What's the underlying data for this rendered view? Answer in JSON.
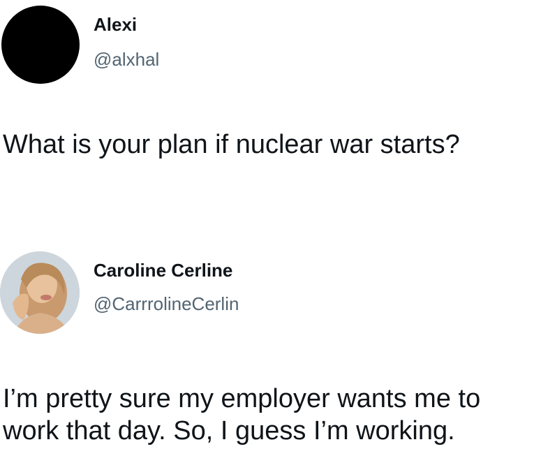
{
  "posts": [
    {
      "author": {
        "name": "Alexi",
        "handle": "@alxhal",
        "avatar_icon": "black-circle-avatar"
      },
      "text_lines": [
        "What is your plan if nuclear war starts?"
      ]
    },
    {
      "author": {
        "name": "Caroline Cerline",
        "handle": "@CarrrolineCerlin",
        "avatar_icon": "profile-photo-avatar"
      },
      "text_lines": [
        "I’m pretty sure my employer wants me to",
        "work that day. So, I guess I’m working."
      ]
    }
  ],
  "colors": {
    "text": "#0f1419",
    "handle": "#536471",
    "background": "#ffffff"
  }
}
